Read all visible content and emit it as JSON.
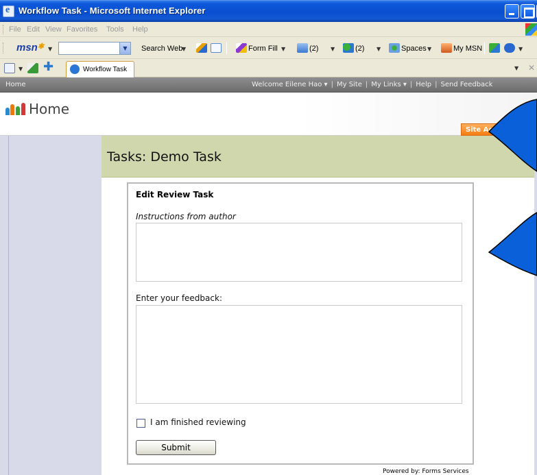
{
  "window": {
    "title": "Workflow Task - Microsoft Internet Explorer"
  },
  "menu": {
    "items": [
      "File",
      "Edit",
      "View",
      "Favorites",
      "Tools",
      "Help"
    ]
  },
  "msn_toolbar": {
    "logo": "msn",
    "search_label": "Search Web",
    "form_fill": "Form Fill",
    "mail_count": "(2)",
    "contacts_count": "(2)",
    "spaces": "Spaces",
    "my_msn": "My MSN"
  },
  "tabs": {
    "active_label": "Workflow Task"
  },
  "sharepoint": {
    "top_link_home": "Home",
    "welcome": "Welcome Eilene Hao ▾",
    "my_site": "My Site",
    "my_links": "My Links ▾",
    "help": "Help",
    "send_feedback": "Send Feedback",
    "site_title": "Home",
    "site_actions": "Site Actions"
  },
  "page": {
    "task_title": "Tasks: Demo Task"
  },
  "form": {
    "heading": "Edit Review Task",
    "instructions_label": "Instructions from author",
    "instructions_value": "",
    "feedback_label": "Enter your feedback:",
    "feedback_value": "",
    "finished_label": "I am finished reviewing",
    "submit_label": "Submit",
    "powered_by": "Powered by: Forms Services"
  },
  "colors": {
    "titlebar_blue": "#0a4fd0",
    "title_band": "#d1d7ad",
    "site_actions_orange": "#f47c10",
    "callout_blue": "#0a60d8",
    "left_nav": "#d8dae9"
  }
}
